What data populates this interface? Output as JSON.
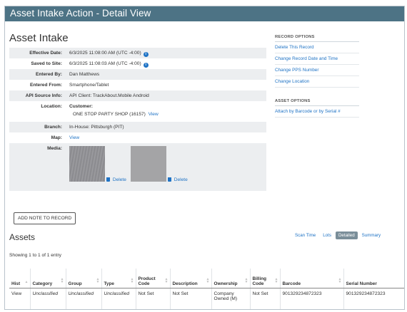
{
  "window": {
    "title": "Asset Intake Action - Detail View"
  },
  "page": {
    "heading": "Asset Intake"
  },
  "details": {
    "effective_date": {
      "label": "Effective Date:",
      "value": "6/3/2025 11:08:00 AM (UTC -4:00)"
    },
    "saved_to_site": {
      "label": "Saved to Site:",
      "value": "6/3/2025 11:08:03 AM (UTC -4:00)"
    },
    "entered_by": {
      "label": "Entered By:",
      "value": "Dan Matthews"
    },
    "entered_from": {
      "label": "Entered From:",
      "value": "Smartphone/Tablet"
    },
    "api_source": {
      "label": "API Source Info:",
      "value": "API Client: TrackAbout.Mobile Android"
    },
    "location": {
      "label": "Location:",
      "heading": "Customer:",
      "value": "ONE STOP PARTY SHOP (16157)",
      "link": "View"
    },
    "branch": {
      "label": "Branch:",
      "value": "In-House: Pittsburgh (PIT)"
    },
    "map": {
      "label": "Map:",
      "link": "View"
    },
    "media": {
      "label": "Media:",
      "delete_label": "Delete"
    },
    "info_glyph": "i"
  },
  "record_options": {
    "heading": "RECORD OPTIONS",
    "items": [
      "Delete This Record",
      "Change Record Date and Time",
      "Change PPS Number",
      "Change Location"
    ]
  },
  "asset_options": {
    "heading": "ASSET OPTIONS",
    "items": [
      "Attach by Barcode or by Serial #"
    ]
  },
  "buttons": {
    "add_note": "ADD NOTE TO RECORD"
  },
  "assets": {
    "title": "Assets",
    "views": [
      "Scan Time",
      "Lots",
      "Detailed",
      "Summary"
    ],
    "active_view": "Detailed",
    "showing": "Showing 1 to 1 of 1 entry",
    "columns": [
      "Hist",
      "Category",
      "Group",
      "Type",
      "Product Code",
      "Description",
      "Ownership",
      "Billing Code",
      "Barcode",
      "Serial Number"
    ],
    "rows": [
      {
        "hist": "View",
        "category": "Unclassified",
        "group": "Unclassified",
        "type": "Unclassified",
        "product_code": "Not Set",
        "description": "Not Set",
        "ownership": "Company Owned (M)",
        "billing_code": "Not Set",
        "barcode": "901329234872323",
        "serial_number": "901329234872323"
      }
    ]
  },
  "colors": {
    "titlebar": "#4d7385",
    "link": "#1f73c5",
    "active_tab": "#7a8e99"
  }
}
